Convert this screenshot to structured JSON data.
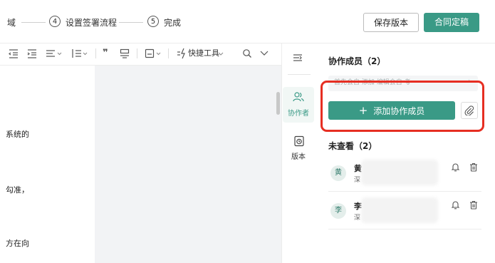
{
  "steps": {
    "partial_label": "域",
    "step4_number": "4",
    "step4_label": "设置签署流程",
    "step5_number": "5",
    "step5_label": "完成"
  },
  "header_buttons": {
    "save_version": "保存版本",
    "finalize": "合同定稿"
  },
  "toolbar": {
    "quote_icon_text": "❞",
    "quick_tools_label": "快捷工具"
  },
  "document": {
    "line1": "系统的",
    "line2": "勾准，",
    "line3": "方在向"
  },
  "rail": {
    "collaborators_label": "协作者",
    "versions_label": "版本"
  },
  "panel": {
    "members_title": "协作成员（2）",
    "hint_text": "首先会自 添加 编辑会自 考一",
    "add_member_label": "添加协作成员",
    "not_viewed_title": "未查看（2）",
    "members": [
      {
        "avatar": "黄",
        "name": "黄",
        "sub": "深"
      },
      {
        "avatar": "李",
        "name": "李",
        "sub": "深"
      }
    ]
  },
  "colors": {
    "accent": "#3a9a86",
    "highlight": "#e62e22"
  }
}
